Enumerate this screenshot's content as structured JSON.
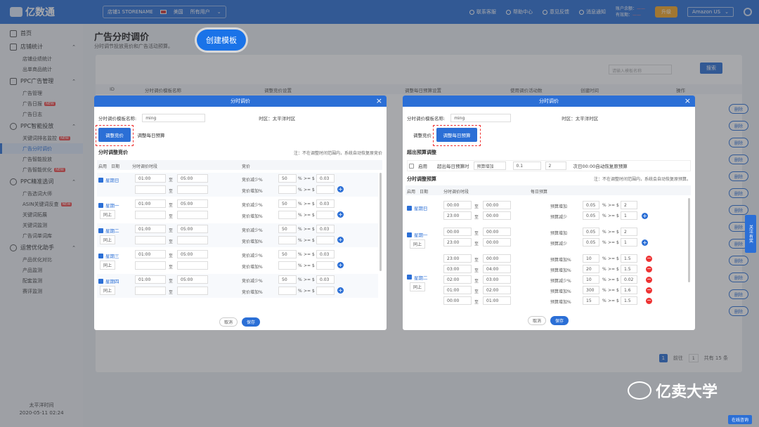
{
  "brand": "亿数通",
  "topbar": {
    "store": "店铺1 STORENAME",
    "country": "美国",
    "users": "所有用户",
    "buttons": [
      "联系客服",
      "帮助中心",
      "意见反馈",
      "消息通知"
    ],
    "acct_line1": "账户余额：",
    "acct_line2": "有效期：",
    "upgrade": "升级",
    "market": "Amazon US"
  },
  "sidebar": {
    "home": "首页",
    "g1": "店铺统计",
    "g1_items": [
      "店铺业绩统计",
      "出单商品统计"
    ],
    "g2": "PPC广告管理",
    "g2_items": [
      "广告管理",
      "广告日报",
      "广告日志"
    ],
    "g3": "PPC智能投放",
    "g3_items": [
      "关键词排名监控",
      "广告分时调价",
      "广告智能投放",
      "广告智能优化"
    ],
    "g4": "PPC精准选词",
    "g4_items": [
      "广告选词大师",
      "ASIN关键词反查",
      "关键词拓展",
      "关键词监测",
      "广告词单词库"
    ],
    "g5": "运营优化助手",
    "g5_items": [
      "产品优化对比",
      "产品监测",
      "配套监测",
      "赛评监测"
    ],
    "new_tag": "NEW",
    "tz": "太平洋时间",
    "datetime": "2020-05-11 02:24"
  },
  "page": {
    "title": "广告分时调价",
    "subtitle": "分时调节投放竞价和广告活动预算。",
    "create_btn": "创建模板",
    "search_placeholder": "请输入模板名称",
    "search_btn": "搜索",
    "cols": [
      "ID",
      "分时调价模板名称",
      "调整竞价设置",
      "调整每日预算设置",
      "使用调价活动数",
      "创建时间",
      "操作"
    ],
    "del": "删除",
    "page_num": "1",
    "goto": "前往",
    "total": "共有 15 条"
  },
  "modalA": {
    "title": "分时调价",
    "name_label": "分时调价模板名称:",
    "name_val": "ming",
    "tz": "时区：太平洋时区",
    "tab1": "调整竞价",
    "tab2": "调整每日预算",
    "section": "分时调整竞价",
    "note": "注：不在调整时间范围内，系统自动恢复原竞价",
    "gh": [
      "启用",
      "日期",
      "分时调价时段",
      "竞价"
    ],
    "rows": [
      {
        "day": "星期日",
        "t1": "01:00",
        "t2": "05:00",
        "t3": "",
        "t4": "",
        "a1": "竞价减少%",
        "v1": "50",
        "b1": "0.03",
        "a2": "竞价增加%",
        "v2": "",
        "b2": ""
      },
      {
        "day": "星期一",
        "t1": "01:00",
        "t2": "05:00",
        "t3": "",
        "t4": "",
        "a1": "竞价减少%",
        "v1": "50",
        "b1": "0.03",
        "a2": "竞价增加%",
        "v2": "",
        "b2": ""
      },
      {
        "day": "星期二",
        "t1": "01:00",
        "t2": "05:00",
        "t3": "",
        "t4": "",
        "a1": "竞价减少%",
        "v1": "50",
        "b1": "0.03",
        "a2": "竞价增加%",
        "v2": "",
        "b2": ""
      },
      {
        "day": "星期三",
        "t1": "01:00",
        "t2": "05:00",
        "t3": "",
        "t4": "",
        "a1": "竞价减少%",
        "v1": "50",
        "b1": "0.03",
        "a2": "竞价增加%",
        "v2": "",
        "b2": ""
      },
      {
        "day": "星期四",
        "t1": "01:00",
        "t2": "05:00",
        "t3": "",
        "t4": "",
        "a1": "竞价减少%",
        "v1": "50",
        "b1": "0.03",
        "a2": "竞价增加%",
        "v2": "",
        "b2": ""
      }
    ],
    "same": "同上",
    "to": "至",
    "unit": "%",
    "gte": ">= $",
    "cancel": "取消",
    "save": "保存"
  },
  "modalB": {
    "title": "分时调价",
    "name_label": "分时调价模板名称:",
    "name_val": "ming",
    "tz": "时区：太平洋时区",
    "tab1": "调整竞价",
    "tab2": "调整每日预算",
    "over_title": "超出预算调整",
    "over_enable": "启用",
    "over_label": "超出每日预算时",
    "over_sel": "预算增加",
    "over_v1": "0.1",
    "over_v2": "2",
    "over_note": "次日00:00自动恢复原预算",
    "section": "分时调整预算",
    "note": "注：不在调整时间范围内，系统会自动恢复原预算。",
    "gh": [
      "启用",
      "日期",
      "分时调价时段",
      "每日预算"
    ],
    "days": [
      {
        "day": "星期日",
        "r": [
          [
            "00:00",
            "00:00",
            "预算增加",
            "0.05",
            "2"
          ],
          [
            "23:00",
            "00:00",
            "预算减少",
            "0.05",
            "1"
          ]
        ]
      },
      {
        "day": "星期一",
        "r": [
          [
            "00:00",
            "00:00",
            "预算增加",
            "0.05",
            "2"
          ],
          [
            "23:00",
            "00:00",
            "预算减少",
            "0.05",
            "1"
          ]
        ]
      },
      {
        "day": "星期二",
        "r": [
          [
            "23:00",
            "00:00",
            "预算增加%",
            "10",
            "1.5"
          ],
          [
            "03:00",
            "04:00",
            "预算增加%",
            "20",
            "1.5"
          ],
          [
            "02:00",
            "03:00",
            "预算减少%",
            "10",
            "0.02"
          ],
          [
            "01:00",
            "02:00",
            "预算增加%",
            "300",
            "1.6"
          ],
          [
            "00:00",
            "01:00",
            "预算增加%",
            "15",
            "1.5"
          ]
        ]
      }
    ],
    "same": "同上",
    "to": "至",
    "unit": "%",
    "gte": ">= $",
    "cancel": "取消",
    "save": "保存"
  },
  "watermark": "亿卖大学",
  "side_tab": "关注 有奖",
  "cs": "在线咨询"
}
